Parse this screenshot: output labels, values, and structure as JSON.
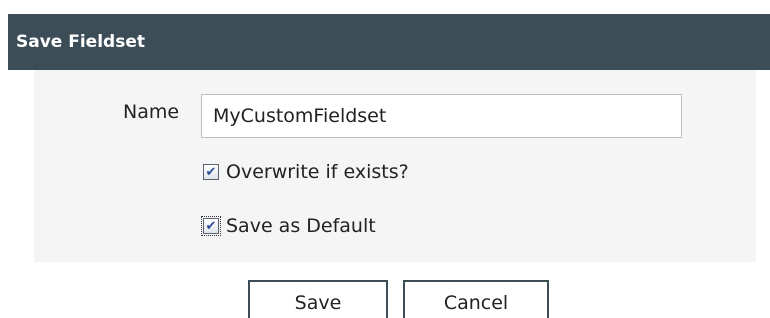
{
  "dialog": {
    "title": "Save Fieldset"
  },
  "form": {
    "name_label": "Name",
    "name_value": "MyCustomFieldset",
    "overwrite": {
      "label": "Overwrite if exists?",
      "checked": true
    },
    "save_default": {
      "label": "Save as Default",
      "checked": true
    },
    "check_glyph": "✔"
  },
  "buttons": {
    "save": "Save",
    "cancel": "Cancel"
  }
}
